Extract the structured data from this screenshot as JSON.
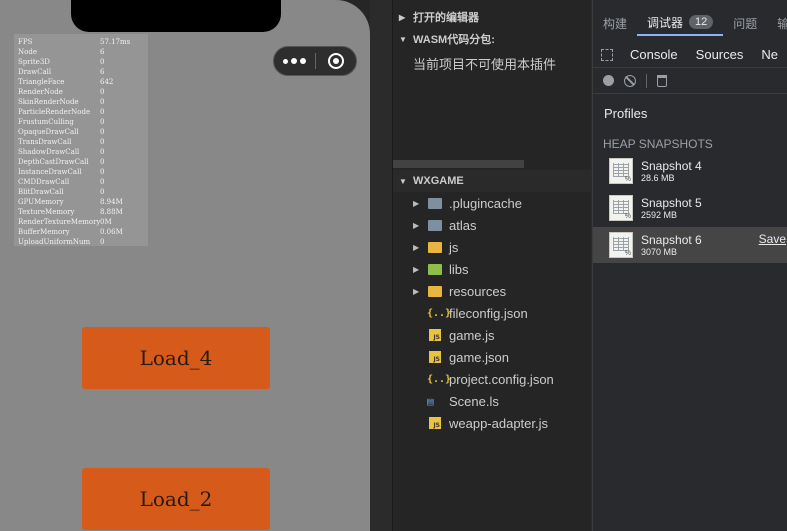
{
  "simulator": {
    "stats": [
      {
        "k": "FPS",
        "v": "57.17ms"
      },
      {
        "k": "Node",
        "v": "6"
      },
      {
        "k": "Sprite3D",
        "v": "0"
      },
      {
        "k": "DrawCall",
        "v": "6"
      },
      {
        "k": "TriangleFace",
        "v": "642"
      },
      {
        "k": "RenderNode",
        "v": "0"
      },
      {
        "k": "SkinRenderNode",
        "v": "0"
      },
      {
        "k": "ParticleRenderNode",
        "v": "0"
      },
      {
        "k": "FrustumCulling",
        "v": "0"
      },
      {
        "k": "OpaqueDrawCall",
        "v": "0"
      },
      {
        "k": "TransDrawCall",
        "v": "0"
      },
      {
        "k": "ShadowDrawCall",
        "v": "0"
      },
      {
        "k": "DepthCastDrawCall",
        "v": "0"
      },
      {
        "k": "InstanceDrawCall",
        "v": "0"
      },
      {
        "k": "CMDDrawCall",
        "v": "0"
      },
      {
        "k": "BlitDrawCall",
        "v": "0"
      },
      {
        "k": "GPUMemory",
        "v": "8.94M"
      },
      {
        "k": "TextureMemory",
        "v": "8.88M"
      },
      {
        "k": "RenderTextureMemory",
        "v": "0M"
      },
      {
        "k": "BufferMemory",
        "v": "0.06M"
      },
      {
        "k": "UploadUniformNum",
        "v": "0"
      }
    ],
    "buttons": [
      "Load_4",
      "Load_2"
    ]
  },
  "explorer": {
    "open_editors": "打开的编辑器",
    "wasm_title": "WASM代码分包:",
    "wasm_message": "当前项目不可使用本插件",
    "project": "WXGAME",
    "files": [
      {
        "name": ".plugincache",
        "kind": "folder-grey",
        "expandable": true
      },
      {
        "name": "atlas",
        "kind": "folder-grey",
        "expandable": true
      },
      {
        "name": "js",
        "kind": "folder-yellow",
        "expandable": true
      },
      {
        "name": "libs",
        "kind": "folder-green",
        "expandable": true
      },
      {
        "name": "resources",
        "kind": "folder-yellow",
        "expandable": true
      },
      {
        "name": "fileconfig.json",
        "kind": "json",
        "expandable": false
      },
      {
        "name": "game.js",
        "kind": "js",
        "expandable": false
      },
      {
        "name": "game.json",
        "kind": "js",
        "expandable": false
      },
      {
        "name": "project.config.json",
        "kind": "json",
        "expandable": false
      },
      {
        "name": "Scene.ls",
        "kind": "ls",
        "expandable": false
      },
      {
        "name": "weapp-adapter.js",
        "kind": "js",
        "expandable": false
      }
    ]
  },
  "devtools": {
    "tabs": [
      "构建",
      "调试器",
      "问题",
      "输"
    ],
    "active_tab": "调试器",
    "badge": "12",
    "subtabs": [
      "Console",
      "Sources",
      "Ne"
    ],
    "profiles_title": "Profiles",
    "heap_title": "HEAP SNAPSHOTS",
    "snapshots": [
      {
        "name": "Snapshot 4",
        "size": "28.6 MB"
      },
      {
        "name": "Snapshot 5",
        "size": "2592 MB"
      },
      {
        "name": "Snapshot 6",
        "size": "3070 MB",
        "selected": true,
        "save": "Save"
      }
    ]
  }
}
